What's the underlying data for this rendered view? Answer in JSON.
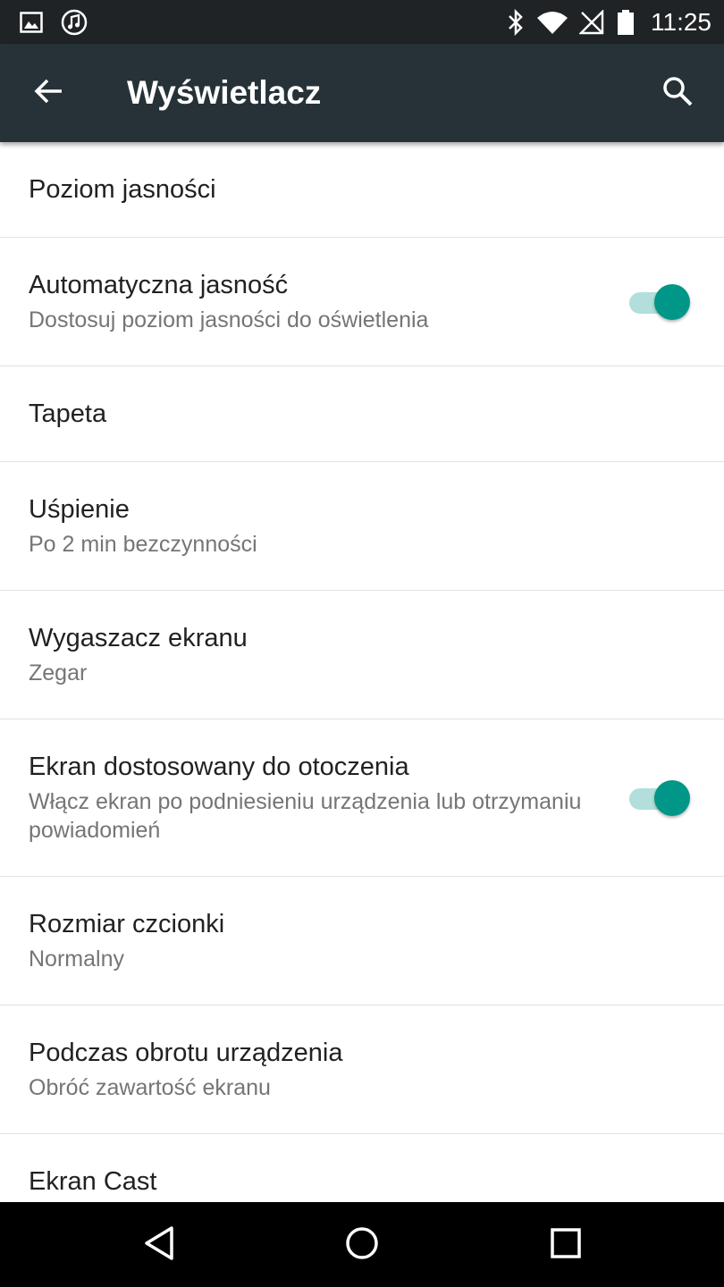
{
  "status_bar": {
    "time": "11:25",
    "icons_left": [
      "image-notification-icon",
      "music-notification-icon"
    ],
    "icons_right": [
      "bluetooth-icon",
      "wifi-icon",
      "no-signal-icon",
      "battery-icon"
    ]
  },
  "app_bar": {
    "title": "Wyświetlacz",
    "back_icon": "arrow-left-icon",
    "search_icon": "search-icon"
  },
  "settings": [
    {
      "title": "Poziom jasności"
    },
    {
      "title": "Automatyczna jasność",
      "subtitle": "Dostosuj poziom jasności do oświetlenia",
      "toggle": true
    },
    {
      "title": "Tapeta"
    },
    {
      "title": "Uśpienie",
      "subtitle": "Po 2 min bezczynności"
    },
    {
      "title": "Wygaszacz ekranu",
      "subtitle": "Zegar"
    },
    {
      "title": "Ekran dostosowany do otoczenia",
      "subtitle": "Włącz ekran po podniesieniu urządzenia lub otrzymaniu powiadomień",
      "toggle": true
    },
    {
      "title": "Rozmiar czcionki",
      "subtitle": "Normalny"
    },
    {
      "title": "Podczas obrotu urządzenia",
      "subtitle": "Obróć zawartość ekranu"
    },
    {
      "title": "Ekran Cast"
    }
  ],
  "colors": {
    "app_bar": "#263238",
    "status_bar": "#1f2326",
    "accent": "#009688",
    "toggle_track": "#b2dfdb"
  },
  "nav_bar": {
    "icons": [
      "back-triangle-icon",
      "home-circle-icon",
      "recents-square-icon"
    ]
  }
}
